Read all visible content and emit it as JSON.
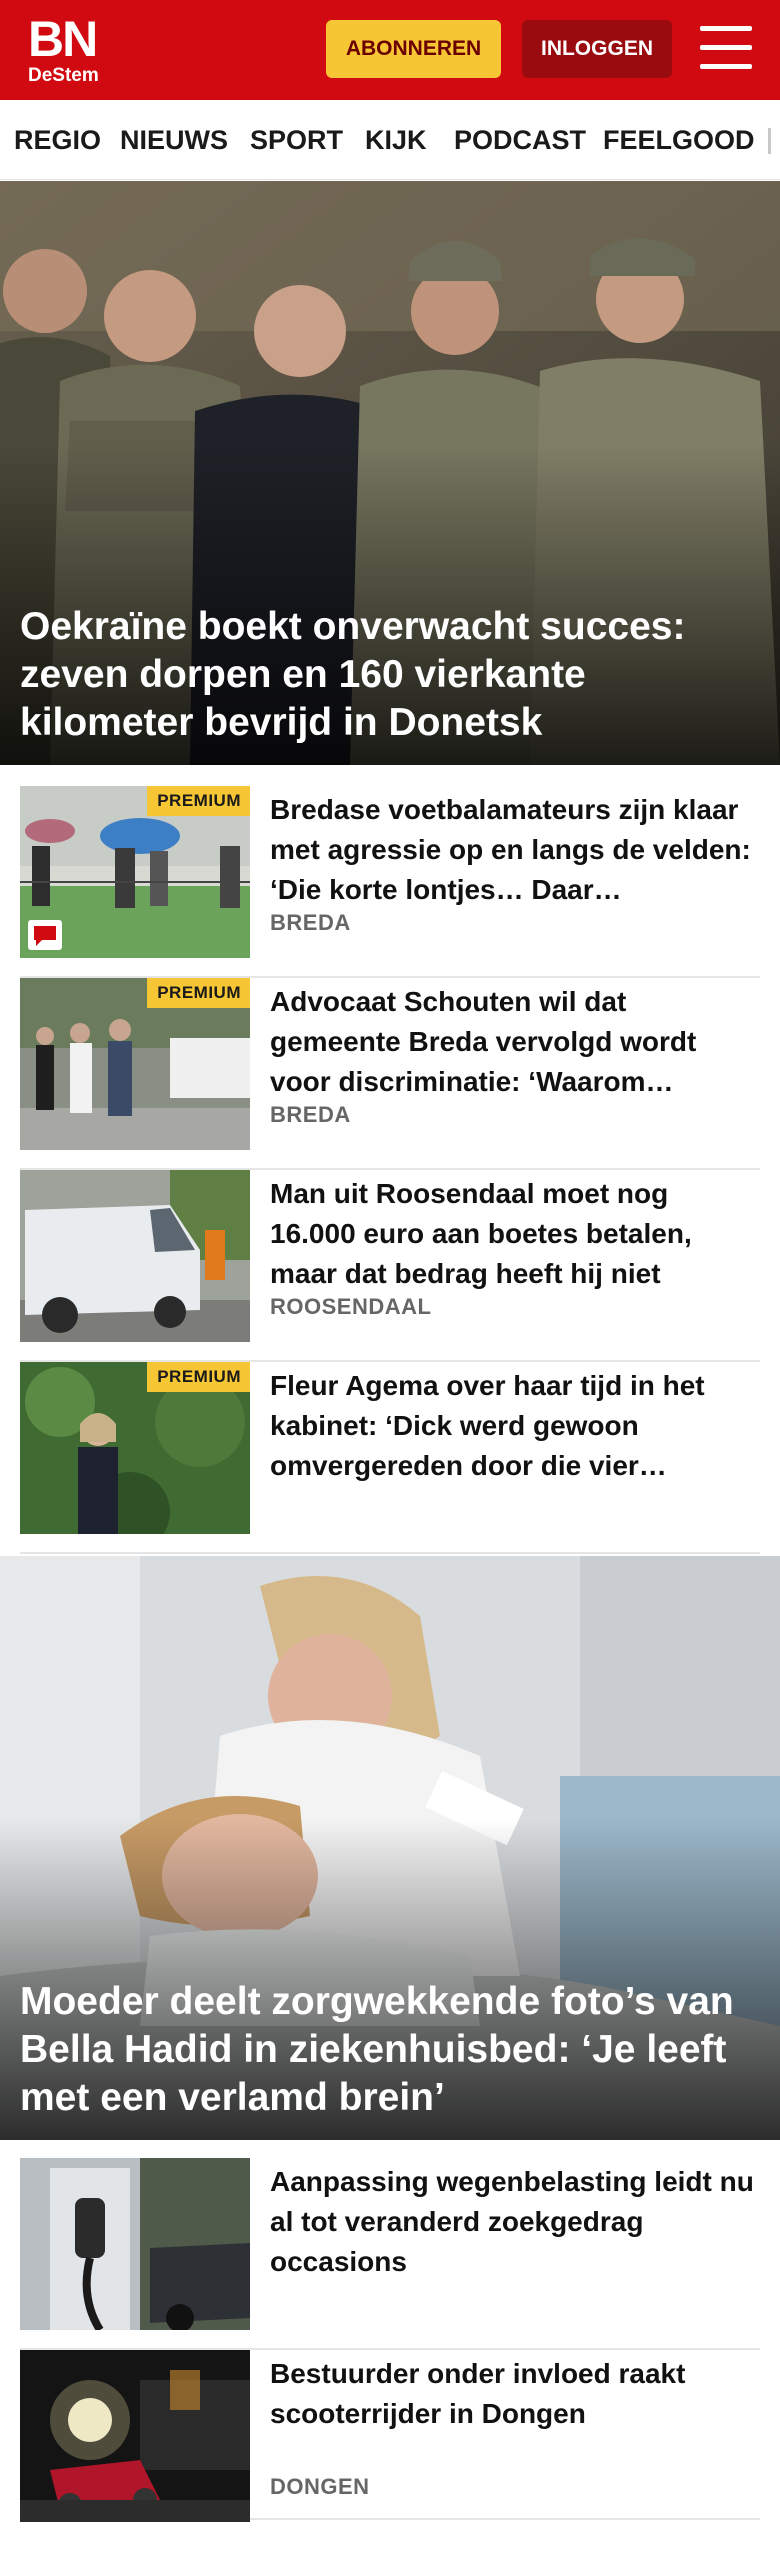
{
  "header": {
    "logo_main": "BN",
    "logo_sub": "DeStem",
    "subscribe_label": "ABONNEREN",
    "login_label": "INLOGGEN",
    "menu_icon": "hamburger-menu-icon",
    "brand_color": "#d10a11",
    "accent_color": "#f6c634"
  },
  "nav": {
    "items": [
      "REGIO",
      "NIEUWS",
      "SPORT",
      "KIJK",
      "PODCAST",
      "FEELGOOD"
    ]
  },
  "hero1": {
    "headline": "Oekraïne boekt onverwacht succes: zeven dorpen en 160 vierkante kilometer bevrijd in Donetsk"
  },
  "articles_top": [
    {
      "title": "Bredase voetbalamateurs zijn klaar met agressie op en langs de velden: ‘Die korte lontjes… Daar…",
      "location": "BREDA",
      "badge": "PREMIUM",
      "has_comments": true
    },
    {
      "title": "Advocaat Schouten wil dat gemeente Breda vervolgd wordt voor discriminatie: ‘Waarom…",
      "location": "BREDA",
      "badge": "PREMIUM"
    },
    {
      "title": "Man uit Roosendaal moet nog 16.000 euro aan boetes betalen, maar dat bedrag heeft hij niet",
      "location": "ROOSENDAAL"
    },
    {
      "title": "Fleur Agema over haar tijd in het kabinet: ‘Dick werd gewoon omvergereden door die vier…",
      "badge": "PREMIUM"
    }
  ],
  "hero2": {
    "headline": "Moeder deelt zorgwekkende foto’s van Bella Hadid in ziekenhuisbed: ‘Je leeft met een verlamd brein’"
  },
  "articles_bottom": [
    {
      "title": "Aanpassing wegenbelasting leidt nu al tot veranderd zoekgedrag occasions"
    },
    {
      "title": "Bestuurder onder invloed raakt scooterrijder in Dongen",
      "location": "DONGEN"
    }
  ]
}
